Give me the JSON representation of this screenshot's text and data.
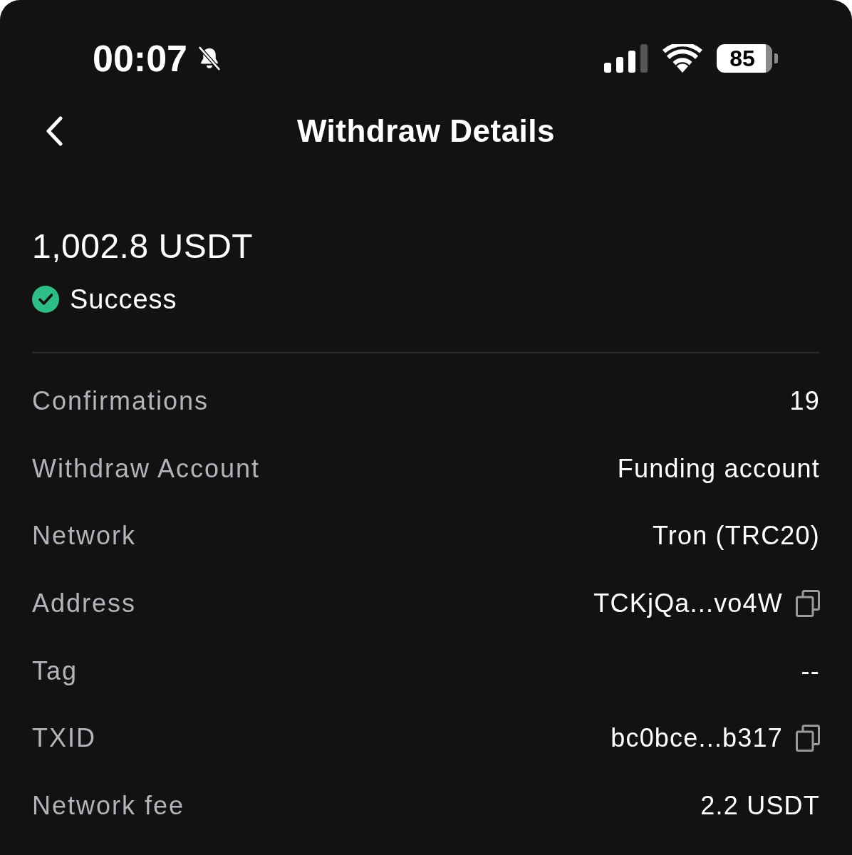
{
  "status_bar": {
    "time": "00:07",
    "battery": "85"
  },
  "header": {
    "title": "Withdraw Details"
  },
  "summary": {
    "amount": "1,002.8 USDT",
    "status": "Success"
  },
  "details": [
    {
      "label": "Confirmations",
      "value": "19",
      "copyable": false
    },
    {
      "label": "Withdraw Account",
      "value": "Funding account",
      "copyable": false
    },
    {
      "label": "Network",
      "value": "Tron (TRC20)",
      "copyable": false
    },
    {
      "label": "Address",
      "value": "TCKjQa...vo4W",
      "copyable": true
    },
    {
      "label": "Tag",
      "value": "--",
      "copyable": false
    },
    {
      "label": "TXID",
      "value": "bc0bce...b317",
      "copyable": true
    },
    {
      "label": "Network fee",
      "value": "2.2 USDT",
      "copyable": false
    }
  ]
}
